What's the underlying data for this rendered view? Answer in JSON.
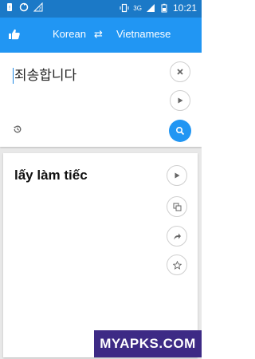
{
  "status_bar": {
    "time": "10:21",
    "network_badge": "3G",
    "icons": [
      "notification-icon",
      "sync-icon",
      "signal-question-icon",
      "vibrate-icon",
      "signal-icon",
      "battery-icon"
    ]
  },
  "app_bar": {
    "source_language": "Korean",
    "swap_symbol": "⇄",
    "target_language": "Vietnamese",
    "accent_color": "#2196f3"
  },
  "input": {
    "text": "죄송합니다"
  },
  "output": {
    "text": "lấy làm tiếc"
  },
  "watermark": {
    "text": "MYAPKS.COM"
  }
}
